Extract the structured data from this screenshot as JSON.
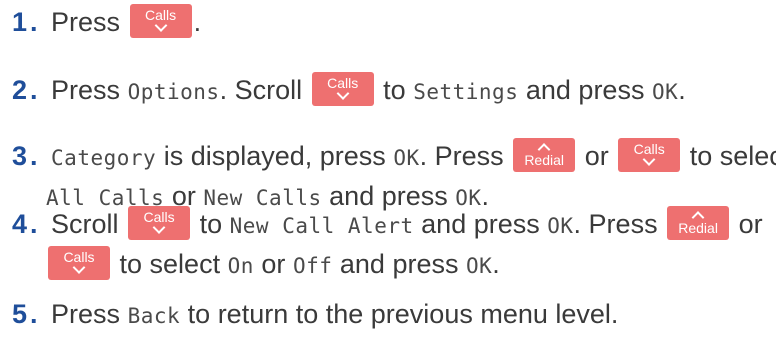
{
  "keys": {
    "calls": {
      "label": "Calls",
      "icon": "chevron-down-icon",
      "color": "#ee7070"
    },
    "redial": {
      "label": "Redial",
      "icon": "chevron-up-icon",
      "color": "#ee7070"
    }
  },
  "colors": {
    "step_number": "#1f4e9a",
    "text": "#3a3a3a"
  },
  "steps": [
    {
      "number": "1",
      "dot": ".",
      "t1": "Press",
      "t2": "."
    },
    {
      "number": "2",
      "dot": ".",
      "t1": "Press",
      "lcd1": "Options",
      "t2": ". Scroll",
      "t3": "to",
      "lcd2": "Settings",
      "t4": "and press",
      "lcd3": "OK",
      "t5": "."
    },
    {
      "number": "3",
      "dot": ".",
      "lcd1": "Category",
      "t1": "is displayed, press",
      "lcd2": "OK",
      "t2": ". Press",
      "t3": "or",
      "t4": "to select",
      "lcd3": "All Calls",
      "t5": "or",
      "lcd4": "New Calls",
      "t6": "and press",
      "lcd5": "OK",
      "t7": "."
    },
    {
      "number": "4",
      "dot": ".",
      "t1": "Scroll",
      "t2": "to",
      "lcd1": "New Call Alert",
      "t3": "and press",
      "lcd2": "OK",
      "t4": ". Press",
      "t5": "or",
      "t6": "to select",
      "lcd3": "On",
      "t7": "or",
      "lcd4": "Off",
      "t8": "and press",
      "lcd5": "OK",
      "t9": "."
    },
    {
      "number": "5",
      "dot": ".",
      "t1": "Press",
      "lcd1": "Back",
      "t2": "to return to the previous menu level."
    }
  ]
}
